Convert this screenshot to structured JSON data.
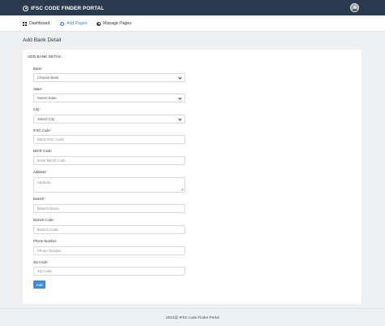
{
  "header": {
    "brand": "IFSC CODE FINDER PORTAL",
    "brand_icon": "globe-icon",
    "avatar_icon": "user-avatar"
  },
  "nav": {
    "items": [
      {
        "label": "Dashboard",
        "icon": "grid-icon",
        "active": false
      },
      {
        "label": "Add Pages",
        "icon": "plus-circle-icon",
        "active": true
      },
      {
        "label": "Manage Pages",
        "icon": "gear-icon",
        "active": false
      }
    ]
  },
  "page": {
    "title": "Add Bank Detail",
    "card_title": "ADD BANK DETAIL"
  },
  "form": {
    "bank": {
      "label": "Bank",
      "required": "*",
      "value": "Choose Bank"
    },
    "state": {
      "label": "State",
      "required": "*",
      "value": "Select State"
    },
    "city": {
      "label": "City",
      "required": "*",
      "value": "Select City"
    },
    "ifsc": {
      "label": "IFSC Code",
      "required": "*",
      "placeholder": "Bank IFSC Code"
    },
    "micr": {
      "label": "MICR Code",
      "required": "*",
      "placeholder": "Enter MICR Code"
    },
    "address": {
      "label": "Address",
      "required": "*",
      "placeholder": "Address"
    },
    "branch": {
      "label": "Branch",
      "required": "*",
      "placeholder": "Branch Name"
    },
    "branch_code": {
      "label": "Branch Code",
      "required": "*",
      "placeholder": "Branch Code"
    },
    "phone": {
      "label": "Phone Number",
      "required": "",
      "placeholder": "Phone Number"
    },
    "zip": {
      "label": "Zip Code",
      "required": "*",
      "placeholder": "Zip Code"
    },
    "submit_label": "Add"
  },
  "footer": {
    "text": "2021@ IFSC code Finder Portal"
  },
  "colors": {
    "topbar": "#2b3a4f",
    "accent": "#3d8bd4",
    "background": "#eef0f2"
  }
}
